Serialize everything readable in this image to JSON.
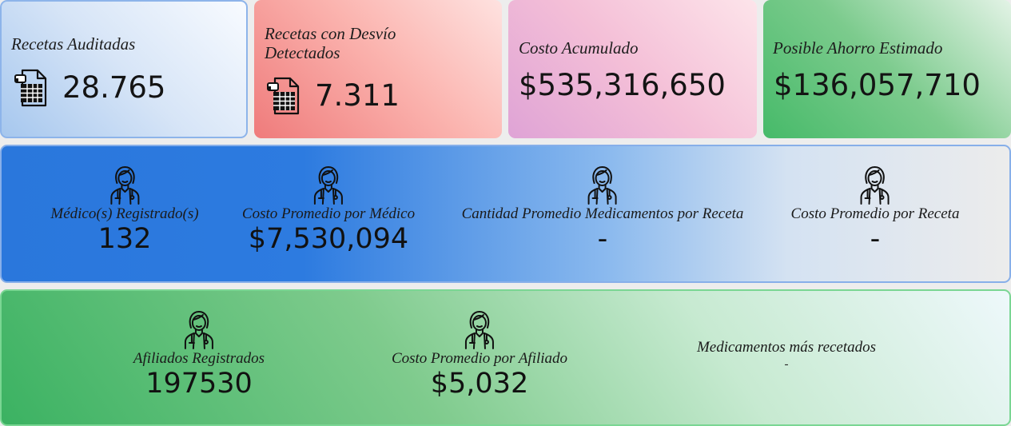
{
  "kpis": {
    "recetas_auditadas": {
      "label": "Recetas Auditadas",
      "value": "28.765",
      "icon": "spreadsheet-file-icon"
    },
    "recetas_desvio": {
      "label": "Recetas con Desvío Detectados",
      "value": "7.311",
      "icon": "spreadsheet-file-icon"
    },
    "costo_acumulado": {
      "label": "Costo Acumulado",
      "value": "$535,316,650"
    },
    "ahorro_estimado": {
      "label": "Posible Ahorro Estimado",
      "value": "$136,057,710"
    }
  },
  "medicos": {
    "registrados": {
      "label": "Médico(s) Registrado(s)",
      "value": "132",
      "icon": "doctor-icon"
    },
    "costo_promedio_medico": {
      "label": "Costo Promedio por Médico",
      "value": "$7,530,094",
      "icon": "doctor-icon"
    },
    "cantidad_promedio_medicamentos": {
      "label": "Cantidad Promedio Medicamentos por Receta",
      "value": "-",
      "icon": "doctor-icon"
    },
    "costo_promedio_receta": {
      "label": "Costo Promedio por Receta",
      "value": "-",
      "icon": "doctor-icon"
    }
  },
  "afiliados": {
    "registrados": {
      "label": "Afiliados Registrados",
      "value": "197530",
      "icon": "doctor-icon"
    },
    "costo_promedio_afiliado": {
      "label": "Costo Promedio por Afiliado",
      "value": "$5,032",
      "icon": "doctor-icon"
    },
    "medicamentos_mas_recetados": {
      "label": "Medicamentos más recetados",
      "value": "-"
    }
  },
  "colors": {
    "card_blue": "#d7e5f7",
    "card_red": "#fbb4af",
    "card_pink": "#f4bfd7",
    "card_green": "#7ccb8d",
    "band_blue": "#2d7be0",
    "band_green": "#3bb262"
  }
}
